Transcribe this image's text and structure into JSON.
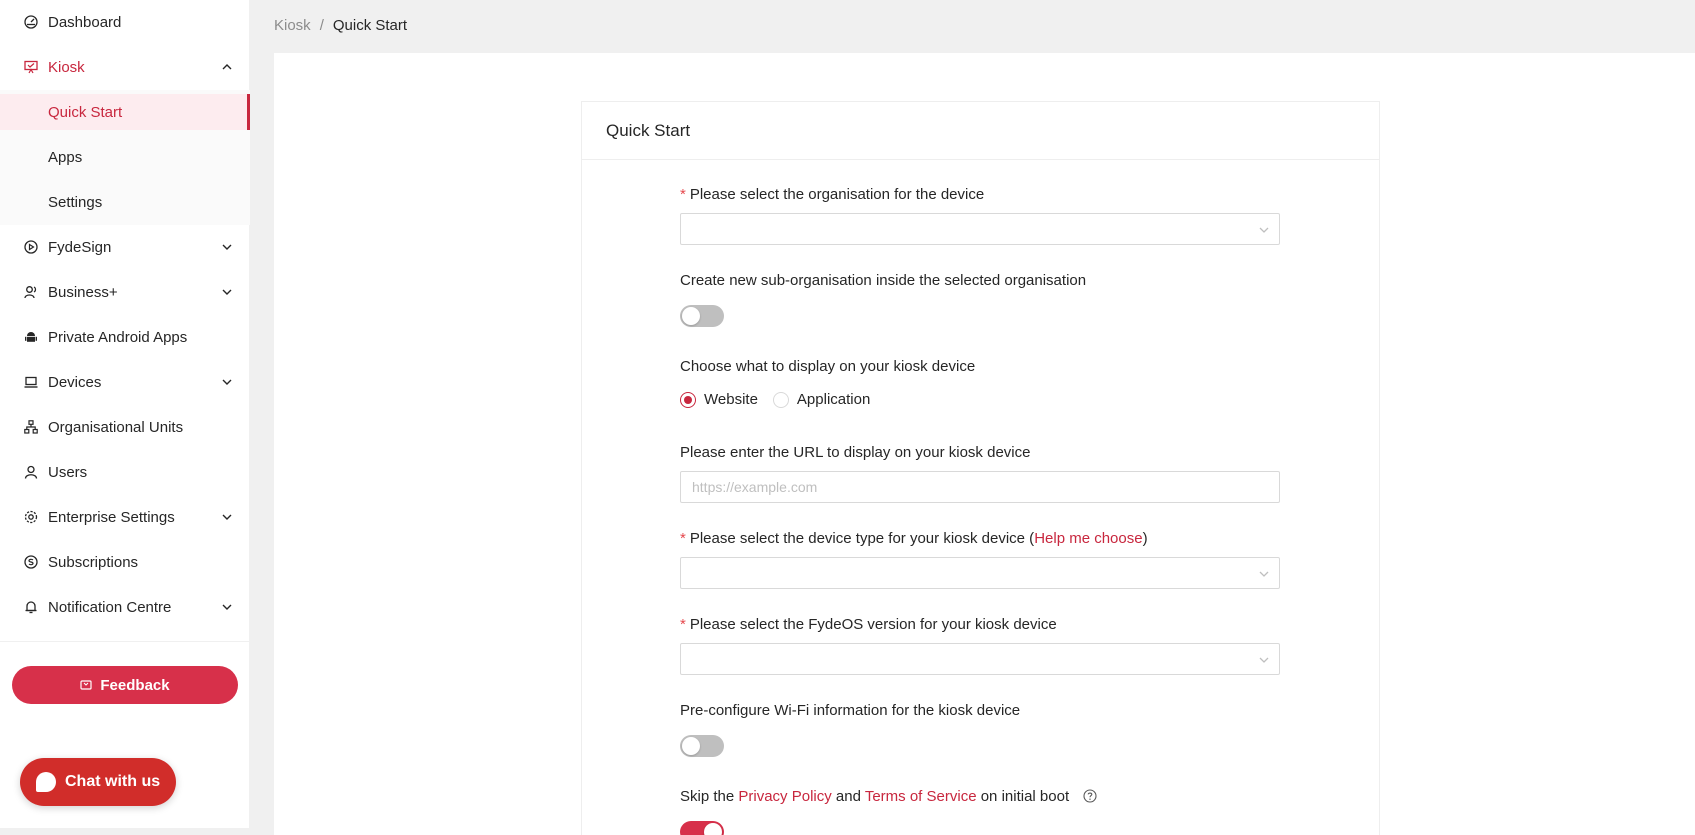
{
  "sidebar": {
    "items": [
      {
        "label": "Dashboard",
        "icon": "dashboard-icon"
      },
      {
        "label": "Kiosk",
        "icon": "kiosk-icon",
        "expanded": true
      },
      {
        "label": "FydeSign",
        "icon": "fydesign-icon"
      },
      {
        "label": "Business+",
        "icon": "business-icon"
      },
      {
        "label": "Private Android Apps",
        "icon": "android-icon"
      },
      {
        "label": "Devices",
        "icon": "laptop-icon"
      },
      {
        "label": "Organisational Units",
        "icon": "org-units-icon"
      },
      {
        "label": "Users",
        "icon": "user-icon"
      },
      {
        "label": "Enterprise Settings",
        "icon": "gear-icon"
      },
      {
        "label": "Subscriptions",
        "icon": "subscriptions-icon"
      },
      {
        "label": "Notification Centre",
        "icon": "bell-icon"
      }
    ],
    "kiosk_sub": [
      {
        "label": "Quick Start",
        "selected": true
      },
      {
        "label": "Apps"
      },
      {
        "label": "Settings"
      }
    ],
    "feedback_label": "Feedback",
    "chat_label": "Chat with us"
  },
  "breadcrumb": {
    "root": "Kiosk",
    "sep": "/",
    "current": "Quick Start"
  },
  "card": {
    "title": "Quick Start",
    "org_label": "Please select the organisation for the device",
    "sub_org_label": "Create new sub-organisation inside the selected organisation",
    "display_label": "Choose what to display on your kiosk device",
    "radio_website": "Website",
    "radio_application": "Application",
    "url_label": "Please enter the URL to display on your kiosk device",
    "url_placeholder": "https://example.com",
    "device_type_label": "Please select the device type for your kiosk device (",
    "help_link": "Help me choose",
    "device_type_close": ")",
    "version_label": "Please select the FydeOS version for your kiosk device",
    "wifi_label": "Pre-configure Wi-Fi information for the kiosk device",
    "skip_prefix": "Skip the",
    "privacy_link": "Privacy Policy",
    "and_text": "and",
    "terms_link": "Terms of Service",
    "skip_suffix": "on initial boot"
  },
  "colors": {
    "accent": "#c8273e",
    "feedback": "#d7304a",
    "chat": "#d12d2a"
  }
}
